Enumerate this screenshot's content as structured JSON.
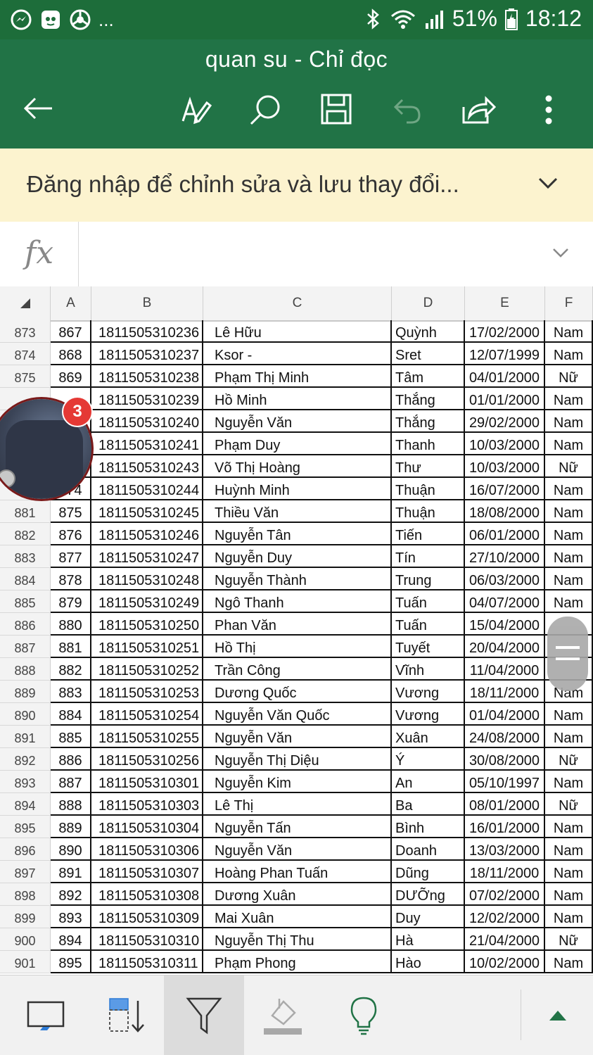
{
  "status_bar": {
    "notification_icons": [
      "messenger-icon",
      "cat-app-icon",
      "chrome-icon"
    ],
    "more": "...",
    "battery": "51%",
    "time": "18:12"
  },
  "title_bar": {
    "title": "quan su - Chỉ đọc"
  },
  "signin_banner": {
    "message": "Đăng nhập để chỉnh sửa và lưu thay đổi..."
  },
  "formula_bar": {
    "fx_label": "fx",
    "value": ""
  },
  "chat_head": {
    "badge": "3"
  },
  "sheet": {
    "columns": [
      "A",
      "B",
      "C",
      "D",
      "E",
      "F"
    ],
    "rows": [
      {
        "n": "873",
        "a": "867",
        "b": "1811505310236",
        "c": "Lê Hữu",
        "d": "Quỳnh",
        "e": "17/02/2000",
        "f": "Nam"
      },
      {
        "n": "874",
        "a": "868",
        "b": "1811505310237",
        "c": "Ksor -",
        "d": "Sret",
        "e": "12/07/1999",
        "f": "Nam"
      },
      {
        "n": "875",
        "a": "869",
        "b": "1811505310238",
        "c": "Phạm Thị Minh",
        "d": "Tâm",
        "e": "04/01/2000",
        "f": "Nữ"
      },
      {
        "n": "",
        "a": "",
        "b": "1811505310239",
        "c": "Hồ Minh",
        "d": "Thắng",
        "e": "01/01/2000",
        "f": "Nam"
      },
      {
        "n": "",
        "a": "",
        "b": "1811505310240",
        "c": "Nguyễn Văn",
        "d": "Thắng",
        "e": "29/02/2000",
        "f": "Nam"
      },
      {
        "n": "",
        "a": "",
        "b": "1811505310241",
        "c": "Phạm Duy",
        "d": "Thanh",
        "e": "10/03/2000",
        "f": "Nam"
      },
      {
        "n": "",
        "a": "",
        "b": "1811505310243",
        "c": "Võ Thị Hoàng",
        "d": "Thư",
        "e": "10/03/2000",
        "f": "Nữ"
      },
      {
        "n": "",
        "a": "874",
        "b": "1811505310244",
        "c": "Huỳnh Minh",
        "d": "Thuận",
        "e": "16/07/2000",
        "f": "Nam"
      },
      {
        "n": "881",
        "a": "875",
        "b": "1811505310245",
        "c": "Thiều Văn",
        "d": "Thuận",
        "e": "18/08/2000",
        "f": "Nam"
      },
      {
        "n": "882",
        "a": "876",
        "b": "1811505310246",
        "c": "Nguyễn Tân",
        "d": "Tiến",
        "e": "06/01/2000",
        "f": "Nam"
      },
      {
        "n": "883",
        "a": "877",
        "b": "1811505310247",
        "c": "Nguyễn Duy",
        "d": "Tín",
        "e": "27/10/2000",
        "f": "Nam"
      },
      {
        "n": "884",
        "a": "878",
        "b": "1811505310248",
        "c": "Nguyễn Thành",
        "d": "Trung",
        "e": "06/03/2000",
        "f": "Nam"
      },
      {
        "n": "885",
        "a": "879",
        "b": "1811505310249",
        "c": "Ngô Thanh",
        "d": "Tuấn",
        "e": "04/07/2000",
        "f": "Nam"
      },
      {
        "n": "886",
        "a": "880",
        "b": "1811505310250",
        "c": "Phan Văn",
        "d": "Tuấn",
        "e": "15/04/2000",
        "f": ""
      },
      {
        "n": "887",
        "a": "881",
        "b": "1811505310251",
        "c": "Hồ Thị",
        "d": "Tuyết",
        "e": "20/04/2000",
        "f": ""
      },
      {
        "n": "888",
        "a": "882",
        "b": "1811505310252",
        "c": "Trần Công",
        "d": "Vĩnh",
        "e": "11/04/2000",
        "f": ""
      },
      {
        "n": "889",
        "a": "883",
        "b": "1811505310253",
        "c": "Dương Quốc",
        "d": "Vương",
        "e": "18/11/2000",
        "f": "Nam"
      },
      {
        "n": "890",
        "a": "884",
        "b": "1811505310254",
        "c": "Nguyễn Văn Quốc",
        "d": "Vương",
        "e": "01/04/2000",
        "f": "Nam"
      },
      {
        "n": "891",
        "a": "885",
        "b": "1811505310255",
        "c": "Nguyễn Văn",
        "d": "Xuân",
        "e": "24/08/2000",
        "f": "Nam"
      },
      {
        "n": "892",
        "a": "886",
        "b": "1811505310256",
        "c": "Nguyễn Thị Diệu",
        "d": "Ý",
        "e": "30/08/2000",
        "f": "Nữ"
      },
      {
        "n": "893",
        "a": "887",
        "b": "1811505310301",
        "c": "Nguyễn Kim",
        "d": "An",
        "e": "05/10/1997",
        "f": "Nam"
      },
      {
        "n": "894",
        "a": "888",
        "b": "1811505310303",
        "c": "Lê Thị",
        "d": "Ba",
        "e": "08/01/2000",
        "f": "Nữ"
      },
      {
        "n": "895",
        "a": "889",
        "b": "1811505310304",
        "c": "Nguyễn Tấn",
        "d": "Bình",
        "e": "16/01/2000",
        "f": "Nam"
      },
      {
        "n": "896",
        "a": "890",
        "b": "1811505310306",
        "c": "Nguyễn Văn",
        "d": "Doanh",
        "e": "13/03/2000",
        "f": "Nam"
      },
      {
        "n": "897",
        "a": "891",
        "b": "1811505310307",
        "c": "Hoàng Phan Tuấn",
        "d": "Dũng",
        "e": "18/11/2000",
        "f": "Nam"
      },
      {
        "n": "898",
        "a": "892",
        "b": "1811505310308",
        "c": "Dương Xuân",
        "d": "DƯỠng",
        "e": "07/02/2000",
        "f": "Nam"
      },
      {
        "n": "899",
        "a": "893",
        "b": "1811505310309",
        "c": "Mai Xuân",
        "d": "Duy",
        "e": "12/02/2000",
        "f": "Nam"
      },
      {
        "n": "900",
        "a": "894",
        "b": "1811505310310",
        "c": "Nguyễn Thị Thu",
        "d": "Hà",
        "e": "21/04/2000",
        "f": "Nữ"
      },
      {
        "n": "901",
        "a": "895",
        "b": "1811505310311",
        "c": "Phạm Phong",
        "d": "Hào",
        "e": "10/02/2000",
        "f": "Nam"
      }
    ]
  },
  "bottom_toolbar": {
    "items": [
      "screen-icon",
      "sort-icon",
      "filter-icon",
      "fill-color-icon",
      "lightbulb-icon",
      "expand-up-icon"
    ],
    "active": "filter-icon"
  },
  "colors": {
    "title_bar": "#217346",
    "status_bar": "#1d6d3a",
    "banner": "#fcf3cf",
    "badge": "#e53935"
  }
}
